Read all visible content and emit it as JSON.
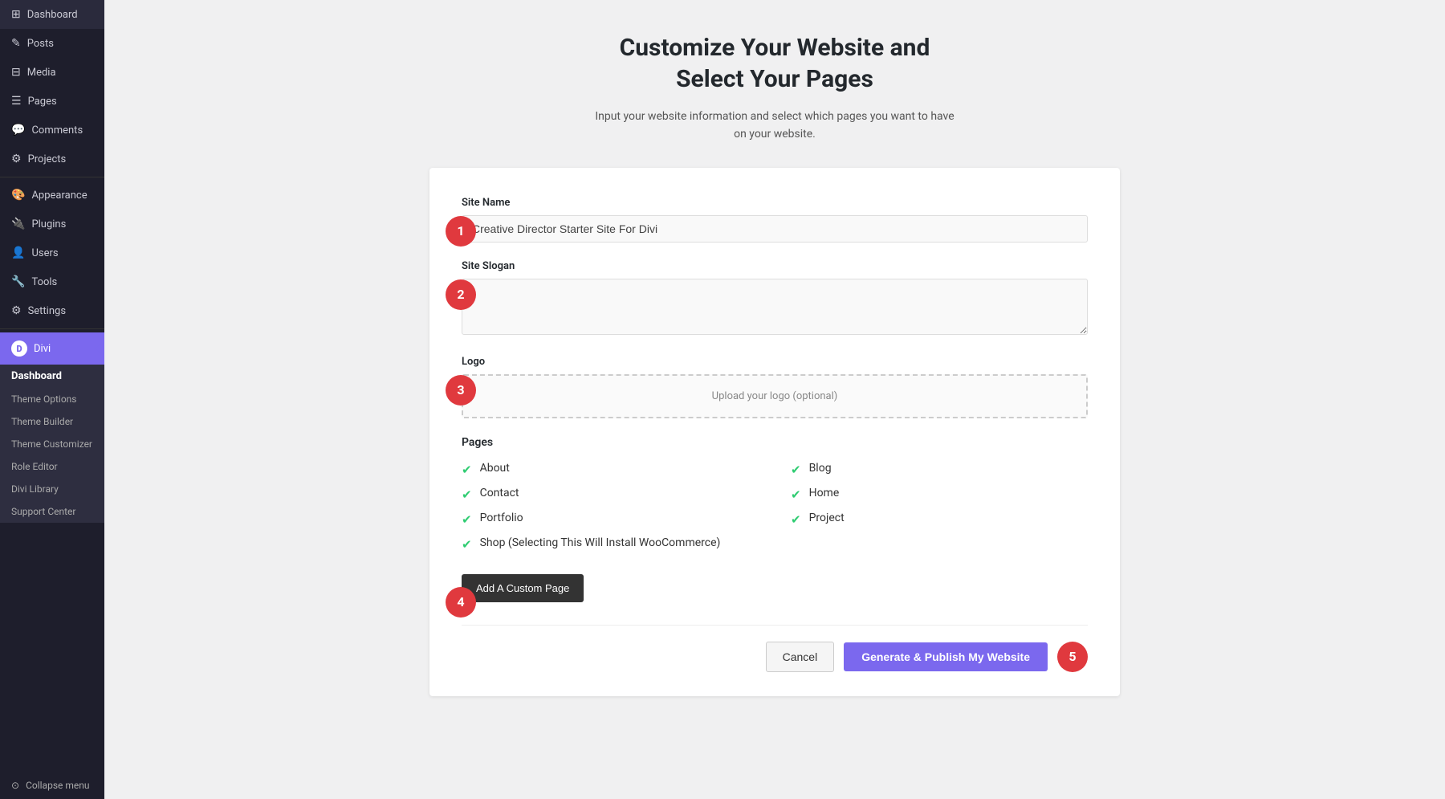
{
  "sidebar": {
    "items": [
      {
        "id": "dashboard",
        "label": "Dashboard",
        "icon": "⊞"
      },
      {
        "id": "posts",
        "label": "Posts",
        "icon": "✎"
      },
      {
        "id": "media",
        "label": "Media",
        "icon": "⊟"
      },
      {
        "id": "pages",
        "label": "Pages",
        "icon": "☰"
      },
      {
        "id": "comments",
        "label": "Comments",
        "icon": "💬"
      },
      {
        "id": "projects",
        "label": "Projects",
        "icon": "⚙"
      },
      {
        "id": "appearance",
        "label": "Appearance",
        "icon": "🎨"
      },
      {
        "id": "plugins",
        "label": "Plugins",
        "icon": "🔌"
      },
      {
        "id": "users",
        "label": "Users",
        "icon": "👤"
      },
      {
        "id": "tools",
        "label": "Tools",
        "icon": "🔧"
      },
      {
        "id": "settings",
        "label": "Settings",
        "icon": "⚙"
      }
    ],
    "divi_label": "Divi",
    "divi_sub_items": [
      {
        "id": "dashboard-sub",
        "label": "Dashboard",
        "bold": true
      },
      {
        "id": "theme-options",
        "label": "Theme Options",
        "bold": false
      },
      {
        "id": "theme-builder",
        "label": "Theme Builder",
        "bold": false
      },
      {
        "id": "theme-customizer",
        "label": "Theme Customizer",
        "bold": false
      },
      {
        "id": "role-editor",
        "label": "Role Editor",
        "bold": false
      },
      {
        "id": "divi-library",
        "label": "Divi Library",
        "bold": false
      },
      {
        "id": "support-center",
        "label": "Support Center",
        "bold": false
      }
    ],
    "collapse_label": "Collapse menu"
  },
  "main": {
    "title": "Customize Your Website and\nSelect Your Pages",
    "subtitle": "Input your website information and select which pages you want to have\non your website.",
    "form": {
      "site_name_label": "Site Name",
      "site_name_value": "Creative Director Starter Site For Divi",
      "site_slogan_label": "Site Slogan",
      "site_slogan_placeholder": "",
      "logo_label": "Logo",
      "logo_upload_text": "Upload your logo (optional)",
      "pages_label": "Pages",
      "pages": [
        {
          "label": "About",
          "checked": true,
          "col": 1
        },
        {
          "label": "Blog",
          "checked": true,
          "col": 2
        },
        {
          "label": "Contact",
          "checked": true,
          "col": 1
        },
        {
          "label": "Home",
          "checked": true,
          "col": 2
        },
        {
          "label": "Portfolio",
          "checked": true,
          "col": 1
        },
        {
          "label": "Project",
          "checked": true,
          "col": 2
        },
        {
          "label": "Shop (Selecting This Will Install WooCommerce)",
          "checked": true,
          "col": 1
        }
      ],
      "add_custom_page_label": "Add A Custom Page",
      "cancel_label": "Cancel",
      "publish_label": "Generate & Publish My Website"
    },
    "steps": {
      "step1": "1",
      "step2": "2",
      "step3": "3",
      "step4": "4",
      "step5": "5"
    }
  }
}
